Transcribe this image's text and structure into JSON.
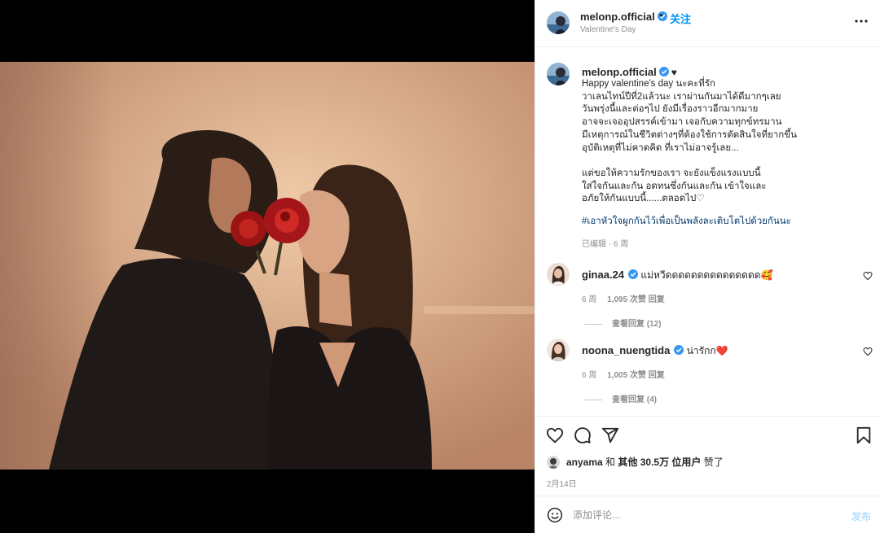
{
  "post": {
    "username": "melonp.official",
    "follow_dot": "•",
    "follow_label": "关注",
    "location": "Valentine's Day"
  },
  "caption": {
    "username": "melonp.official",
    "heart": "♥",
    "body": "Happy valentine's day นะคะที่รัก\nวาเลนไทน์ปีที่2แล้วนะ เราผ่านกันมาได้ดีมากๆเลย\nวันพรุ่งนี้และต่อๆไป ยังมีเรื่องราวอีกมากมาย\nอาจจะเจออุปสรรค์เข้ามา เจอกับความทุกข์ทรมาน\nมีเหตุการณ์ในชีวิตต่างๆที่ต้องใช้การตัดสินใจที่ยากขึ้น\nอุบัติเหตุที่ไม่คาดคิด ที่เราไม่อาจรู้เลย...\n\nแต่ขอให้ความรักของเรา จะยังแข็งแรงแบบนี้\nใส่ใจกันและกัน อดทนซึ่งกันและกัน เข้าใจและ\nอภัยให้กันแบบนี้......ตลอดไป♡",
    "hashtags": "#เอาหัวใจผูกกันไว้เพื่อเป็นพลังละเติบโตไปด้วยกันนะ",
    "meta": "已编辑 · 6 周"
  },
  "comments": [
    {
      "username": "ginaa.24",
      "text": "แม่หวีดดดดดดดดดดดดดดด🥰",
      "age": "6 周",
      "likes": "1,095 次赞",
      "reply": "回复",
      "view_replies": "查看回复 (12)"
    },
    {
      "username": "noona_nuengtida",
      "text": "น่ารักก❤️",
      "age": "6 周",
      "likes": "1,005 次赞",
      "reply": "回复",
      "view_replies": "查看回复 (4)"
    }
  ],
  "likes_line": {
    "liker": "anyama",
    "and": "和",
    "others": "其他 30.5万 位用户",
    "suffix": "赞了"
  },
  "date": "2月14日",
  "composer": {
    "placeholder": "添加评论...",
    "post_label": "发布"
  },
  "colors": {
    "accent": "#0095f6",
    "verified": "#3897f0",
    "heart_red": "#ed4956"
  },
  "icons": [
    "verified-badge-icon",
    "more-icon",
    "heart-icon",
    "comment-icon",
    "share-icon",
    "bookmark-icon",
    "emoji-icon"
  ]
}
